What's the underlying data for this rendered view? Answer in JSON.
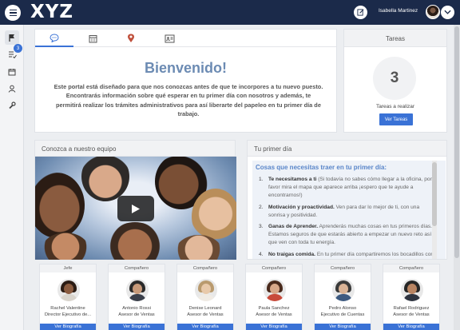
{
  "header": {
    "logo": "XYZ",
    "user_name": "Isabella Martinez"
  },
  "sidebar": {
    "items": [
      {
        "icon": "flag-icon"
      },
      {
        "icon": "checklist-icon",
        "badge": "3"
      },
      {
        "icon": "calendar-icon"
      },
      {
        "icon": "user-icon"
      },
      {
        "icon": "wrench-icon"
      }
    ]
  },
  "welcome": {
    "tabs": [
      {
        "icon": "chat-icon",
        "active": true
      },
      {
        "icon": "calendar-icon"
      },
      {
        "icon": "map-pin-icon"
      },
      {
        "icon": "contact-card-icon"
      }
    ],
    "title": "Bienvenido!",
    "text": "Este portal está diseñado para que nos conozcas antes de que te incorpores a tu nuevo puesto. Encontrarás información sobre qué esperar en tu primer día con nosotros y además, te permitirá realizar los trámites administrativos para así liberarte del papeleo en tu primer día de trabajo."
  },
  "tareas": {
    "title": "Tareas",
    "count": "3",
    "label": "Tareas a realizar",
    "button": "Ver Tareas"
  },
  "equipo": {
    "title": "Conozca a nuestro equipo"
  },
  "primer_dia": {
    "title": "Tu primer día",
    "heading": "Cosas que necesitas traer en tu primer día:",
    "items": [
      {
        "num": "1.",
        "bold": "Te necesitamos a ti",
        "desc": " (Si todavía no sabes cómo llegar a la oficina, por favor mira el mapa que aparece arriba ¡espero que te ayude a encontrarnos!)"
      },
      {
        "num": "2.",
        "bold": "Motivación y proactividad.",
        "desc": " Ven para dar lo mejor de ti, con una sonrisa y positividad."
      },
      {
        "num": "3.",
        "bold": "Ganas de Aprender.",
        "desc": " Aprenderás muchas cosas en tus primeros días. Estamos seguros de que estarás abierto a empezar un nuevo reto así que ven con toda tu energía."
      },
      {
        "num": "4.",
        "bold": "No traigas comida.",
        "desc": " En tu primer día compartiremos los bocadillos con el equipo."
      }
    ]
  },
  "team": [
    {
      "role": "Jefe",
      "name": "Rachel Valentine",
      "title": "Director Ejecutivo de...",
      "button": "Ver Biografía",
      "hair": "#2b1c14",
      "skin": "#8a5b3f",
      "shirt": "#d9d4cc"
    },
    {
      "role": "Compañero",
      "name": "Antonio Rossi",
      "title": "Asesor de Ventas",
      "button": "Ver Biografía",
      "hair": "#2a2a2a",
      "skin": "#c79a7a",
      "shirt": "#3a3f4a"
    },
    {
      "role": "Compañero",
      "name": "Denise Leonard",
      "title": "Asesor de Ventas",
      "button": "Ver Biografía",
      "hair": "#b99a6e",
      "skin": "#e8c9aa",
      "shirt": "#f0ebe4"
    },
    {
      "role": "Compañero",
      "name": "Paula Sanchez",
      "title": "Asesor de Ventas",
      "button": "Ver Biografía",
      "hair": "#4a2a1c",
      "skin": "#d8a889",
      "shirt": "#c84a3a"
    },
    {
      "role": "Compañero",
      "name": "Pedro Alonso",
      "title": "Ejecutivo de Cuentas",
      "button": "Ver Biografía",
      "hair": "#3a3a3a",
      "skin": "#d9b396",
      "shirt": "#3d5a80"
    },
    {
      "role": "Compañero",
      "name": "Rafael Rodriguez",
      "title": "Asesor de Ventas",
      "button": "Ver Biografía",
      "hair": "#262626",
      "skin": "#b88462",
      "shirt": "#2e3440"
    }
  ],
  "colors": {
    "topbar": "#1b2a4a",
    "accent": "#3a72d6",
    "title": "#6c8bb3"
  }
}
